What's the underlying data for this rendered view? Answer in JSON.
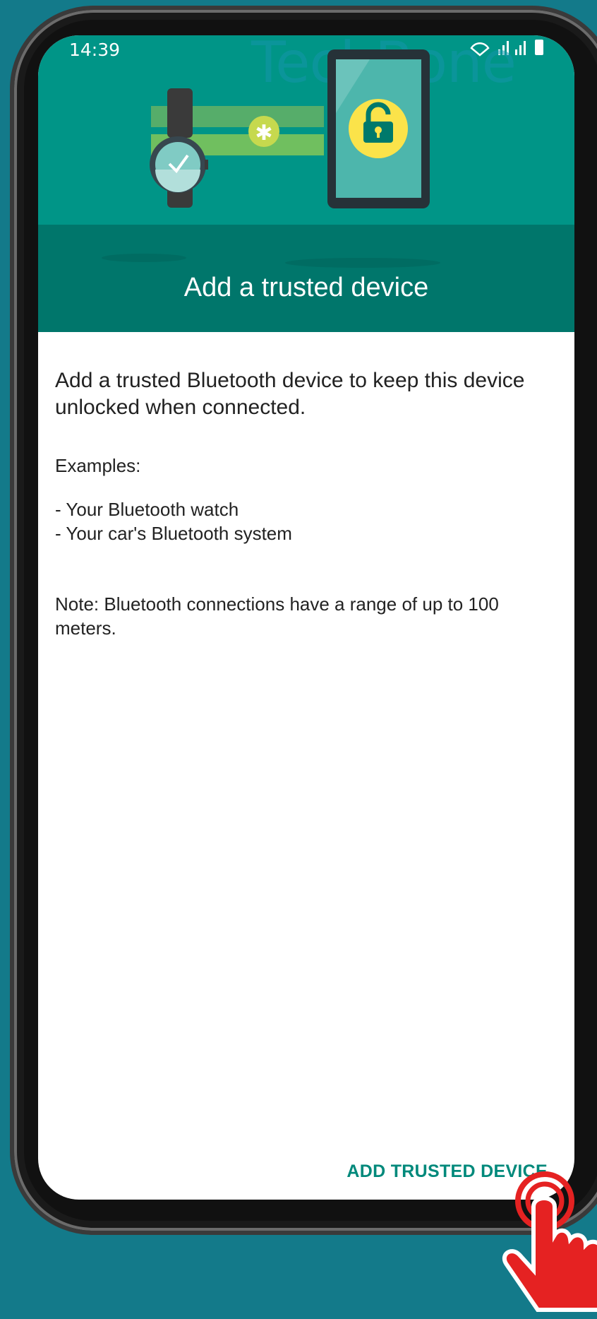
{
  "status_bar": {
    "time": "14:39",
    "icons": "▲.ıl .ıl ▮"
  },
  "watermark": "TechBone",
  "header": {
    "title": "Add a trusted device"
  },
  "content": {
    "description": "Add a trusted Bluetooth device to keep this device unlocked when connected.",
    "examples_heading": "Examples:",
    "examples": [
      "- Your Bluetooth watch",
      "- Your car's Bluetooth system"
    ],
    "note": "Note: Bluetooth connections have a range of up to 100 meters."
  },
  "actions": {
    "add_button": "ADD TRUSTED DEVICE"
  },
  "colors": {
    "background": "#137a8a",
    "header": "#009587",
    "header_band": "#00766b",
    "accent": "#00897b",
    "pointer": "#e52222"
  }
}
